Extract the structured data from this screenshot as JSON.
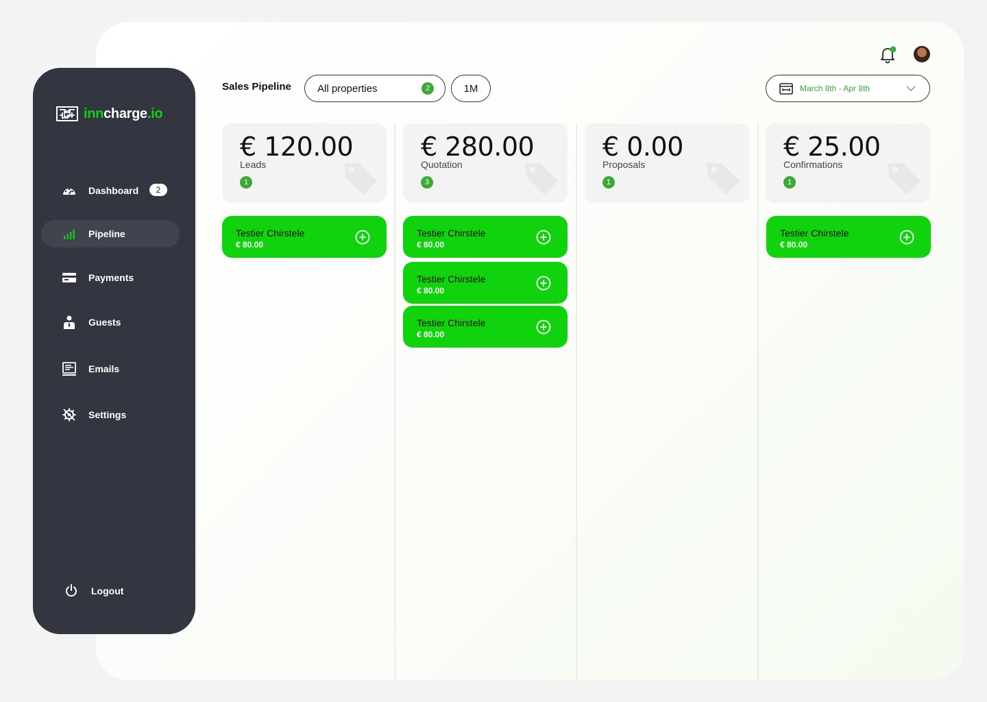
{
  "brand": {
    "logo_part1": "inn",
    "logo_part2": "charge",
    "logo_part3": ".io"
  },
  "sidebar": {
    "items": [
      {
        "label": "Dashboard",
        "badge": "2",
        "icon": "dashboard-gauge-icon"
      },
      {
        "label": "Pipeline",
        "icon": "signal-bars-icon",
        "active": true
      },
      {
        "label": "Payments",
        "icon": "credit-card-icon"
      },
      {
        "label": "Guests",
        "icon": "person-icon"
      },
      {
        "label": "Emails",
        "icon": "document-icon"
      },
      {
        "label": "Settings",
        "icon": "gear-icon"
      }
    ],
    "logout": {
      "label": "Logout",
      "icon": "power-icon"
    }
  },
  "header": {
    "title": "Sales Pipeline",
    "property_filter": {
      "label": "All properties",
      "badge": "2"
    },
    "period_button": "1M",
    "date_range": "March 8th - Apr 8th"
  },
  "pipeline": {
    "columns": [
      {
        "amount": "€ 120.00",
        "label": "Leads",
        "count": "1",
        "deals": [
          {
            "name": "Testier Chirstele",
            "value": "€ 80.00"
          }
        ]
      },
      {
        "amount": "€ 280.00",
        "label": "Quotation",
        "count": "3",
        "deals": [
          {
            "name": "Testier Chirstele",
            "value": "€ 80.00"
          },
          {
            "name": "Testier Chirstele",
            "value": "€ 80.00"
          },
          {
            "name": "Testier Chirstele",
            "value": "€ 80.00"
          }
        ]
      },
      {
        "amount": "€ 0.00",
        "label": "Proposals",
        "count": "1",
        "deals": []
      },
      {
        "amount": "€ 25.00",
        "label": "Confirmations",
        "count": "1",
        "deals": [
          {
            "name": "Testier Chirstele",
            "value": "€ 80.00"
          }
        ]
      }
    ]
  },
  "colors": {
    "accent_green": "#11d30d",
    "badge_green": "#3aa935",
    "sidebar_bg": "#333640"
  }
}
